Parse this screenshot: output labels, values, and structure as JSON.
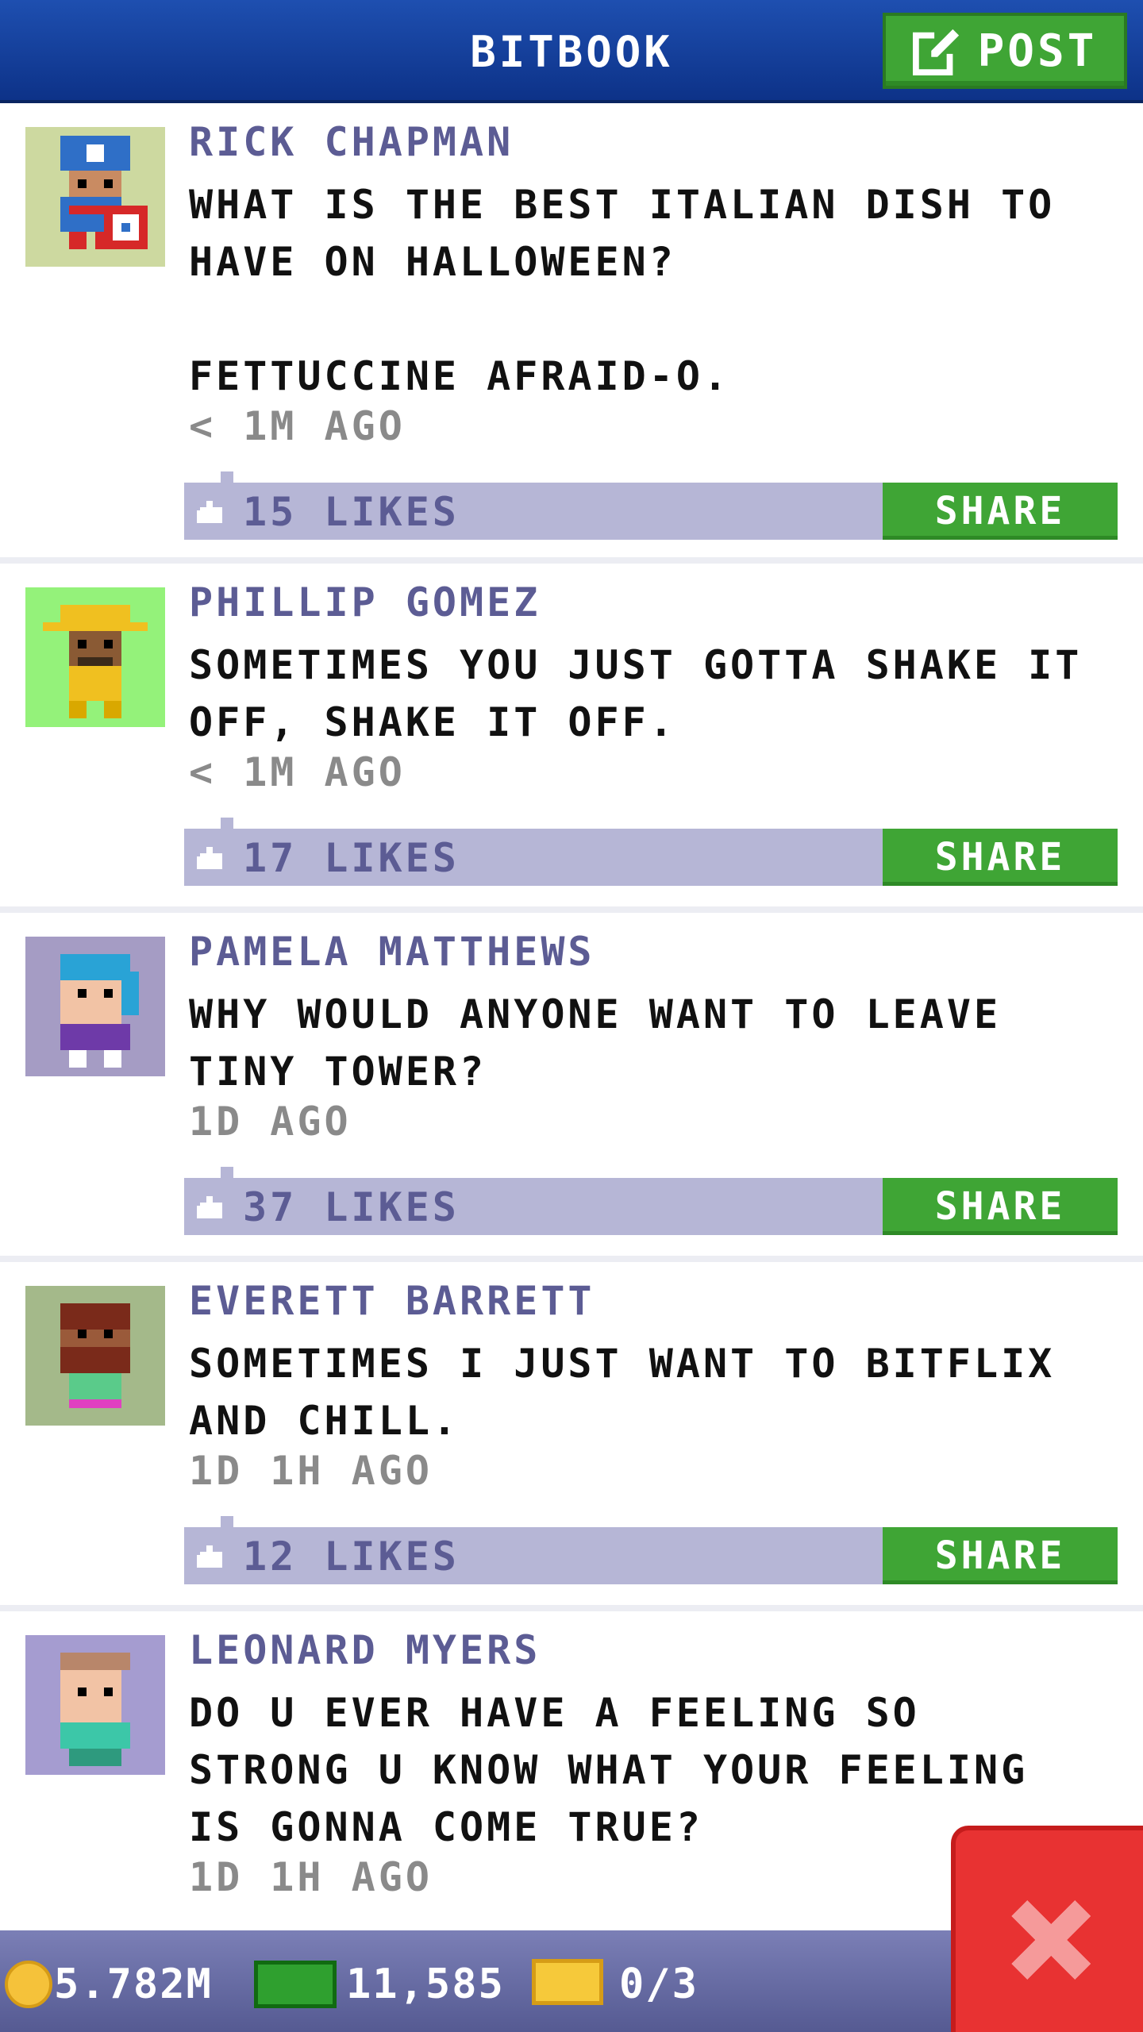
{
  "header": {
    "title": "BITBOOK",
    "post_label": "POST"
  },
  "posts": [
    {
      "author": "RICK CHAPMAN",
      "message": "WHAT IS THE BEST ITALIAN DISH TO\nHAVE ON HALLOWEEN?\n\nFETTUCCINE AFRAID-O.",
      "time": "< 1M AGO",
      "likes": "15 LIKES",
      "share": "SHARE"
    },
    {
      "author": "PHILLIP GOMEZ",
      "message": "SOMETIMES YOU JUST GOTTA SHAKE IT\nOFF, SHAKE IT OFF.",
      "time": "< 1M AGO",
      "likes": "17 LIKES",
      "share": "SHARE"
    },
    {
      "author": "PAMELA MATTHEWS",
      "message": "WHY WOULD ANYONE WANT TO LEAVE\nTINY TOWER?",
      "time": "1D AGO",
      "likes": "37 LIKES",
      "share": "SHARE"
    },
    {
      "author": "EVERETT BARRETT",
      "message": "SOMETIMES I JUST WANT TO BITFLIX\nAND CHILL.",
      "time": "1D 1H AGO",
      "likes": "12 LIKES",
      "share": "SHARE"
    },
    {
      "author": "LEONARD MYERS",
      "message": "DO U EVER HAVE A FEELING SO\nSTRONG U KNOW WHAT YOUR FEELING\nIS GONNA COME TRUE?",
      "time": "1D 1H AGO"
    }
  ],
  "status": {
    "coins": "5.782M",
    "bux": "11,585",
    "tickets": "0/3"
  },
  "colors": {
    "header_blue": "#1e4fb0",
    "accent_green": "#3fa535",
    "likes_bar": "#b6b6d6",
    "close_red": "#e83232"
  }
}
